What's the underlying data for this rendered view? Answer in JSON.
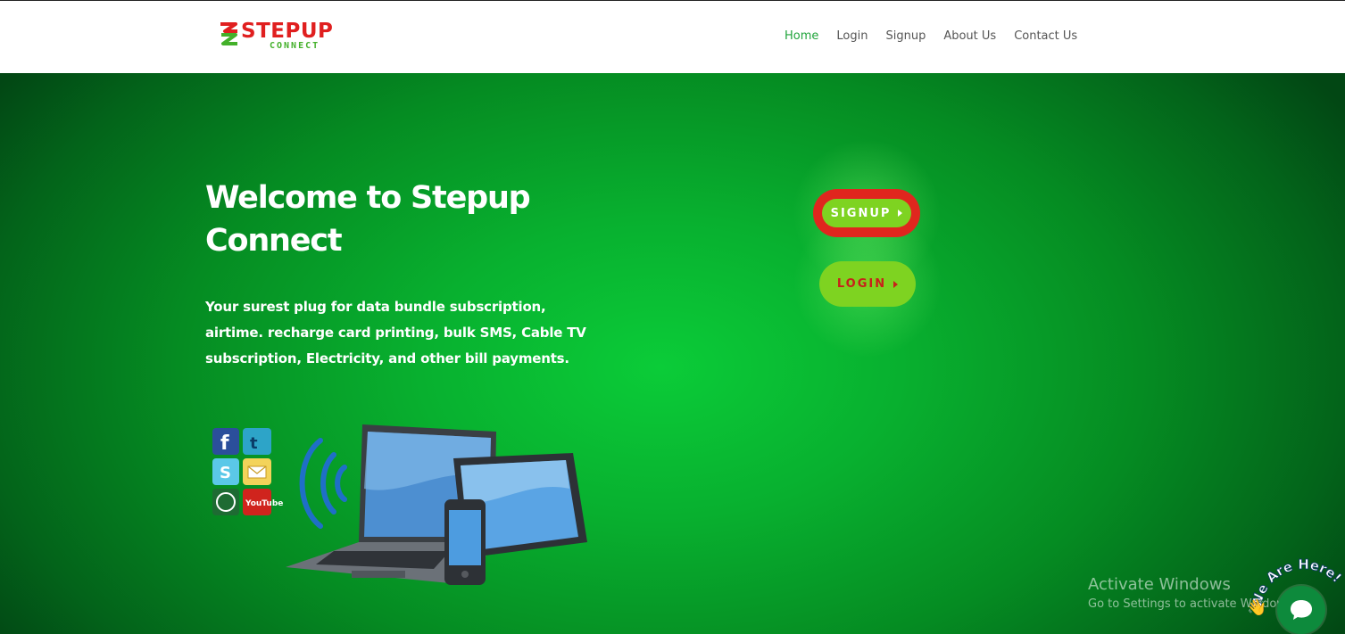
{
  "brand": {
    "name_main": "STEPUP",
    "name_sub": "CONNECT",
    "primary_color": "#e01f1f",
    "secondary_color": "#43b02a"
  },
  "nav": {
    "items": [
      {
        "label": "Home",
        "active": true
      },
      {
        "label": "Login",
        "active": false
      },
      {
        "label": "Signup",
        "active": false
      },
      {
        "label": "About Us",
        "active": false
      },
      {
        "label": "Contact Us",
        "active": false
      }
    ],
    "active_color": "#20a43b"
  },
  "hero": {
    "title": "Welcome to Stepup Connect",
    "description": "Your surest plug for data bundle subscription, airtime. recharge card printing, bulk SMS, Cable TV subscription, Electricity, and other bill payments.",
    "background_color": "#08b02f",
    "illustration": "laptop-tablet-phone-social-apps-image"
  },
  "buttons": {
    "signup_label": "SIGNUP",
    "login_label": "LOGIN",
    "button_color": "#7ed321",
    "highlight_color": "#e0261e"
  },
  "watermark": {
    "title": "Activate Windows",
    "subtitle": "Go to Settings to activate Windows."
  },
  "chat_widget": {
    "label": "We Are Here!",
    "icon": "chat-bubble-icon"
  }
}
